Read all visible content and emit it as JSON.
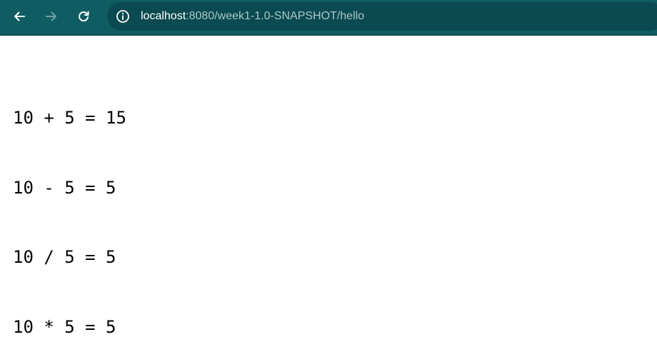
{
  "browser": {
    "url_host": "localhost",
    "url_rest": ":8080/week1-1.0-SNAPSHOT/hello",
    "back_icon": "arrow-left-icon",
    "forward_icon": "arrow-right-icon",
    "reload_icon": "reload-icon",
    "site_info_icon": "info-circle-icon",
    "colors": {
      "toolbar_bg": "#0f5d63",
      "omnibox_bg": "#0b4a50",
      "url_host": "#ffffff",
      "url_rest": "#a9c7ca"
    }
  },
  "page": {
    "lines": [
      "10 + 5 = 15",
      "10 - 5 = 5",
      "10 / 5 = 5",
      "10 * 5 = 5"
    ]
  }
}
